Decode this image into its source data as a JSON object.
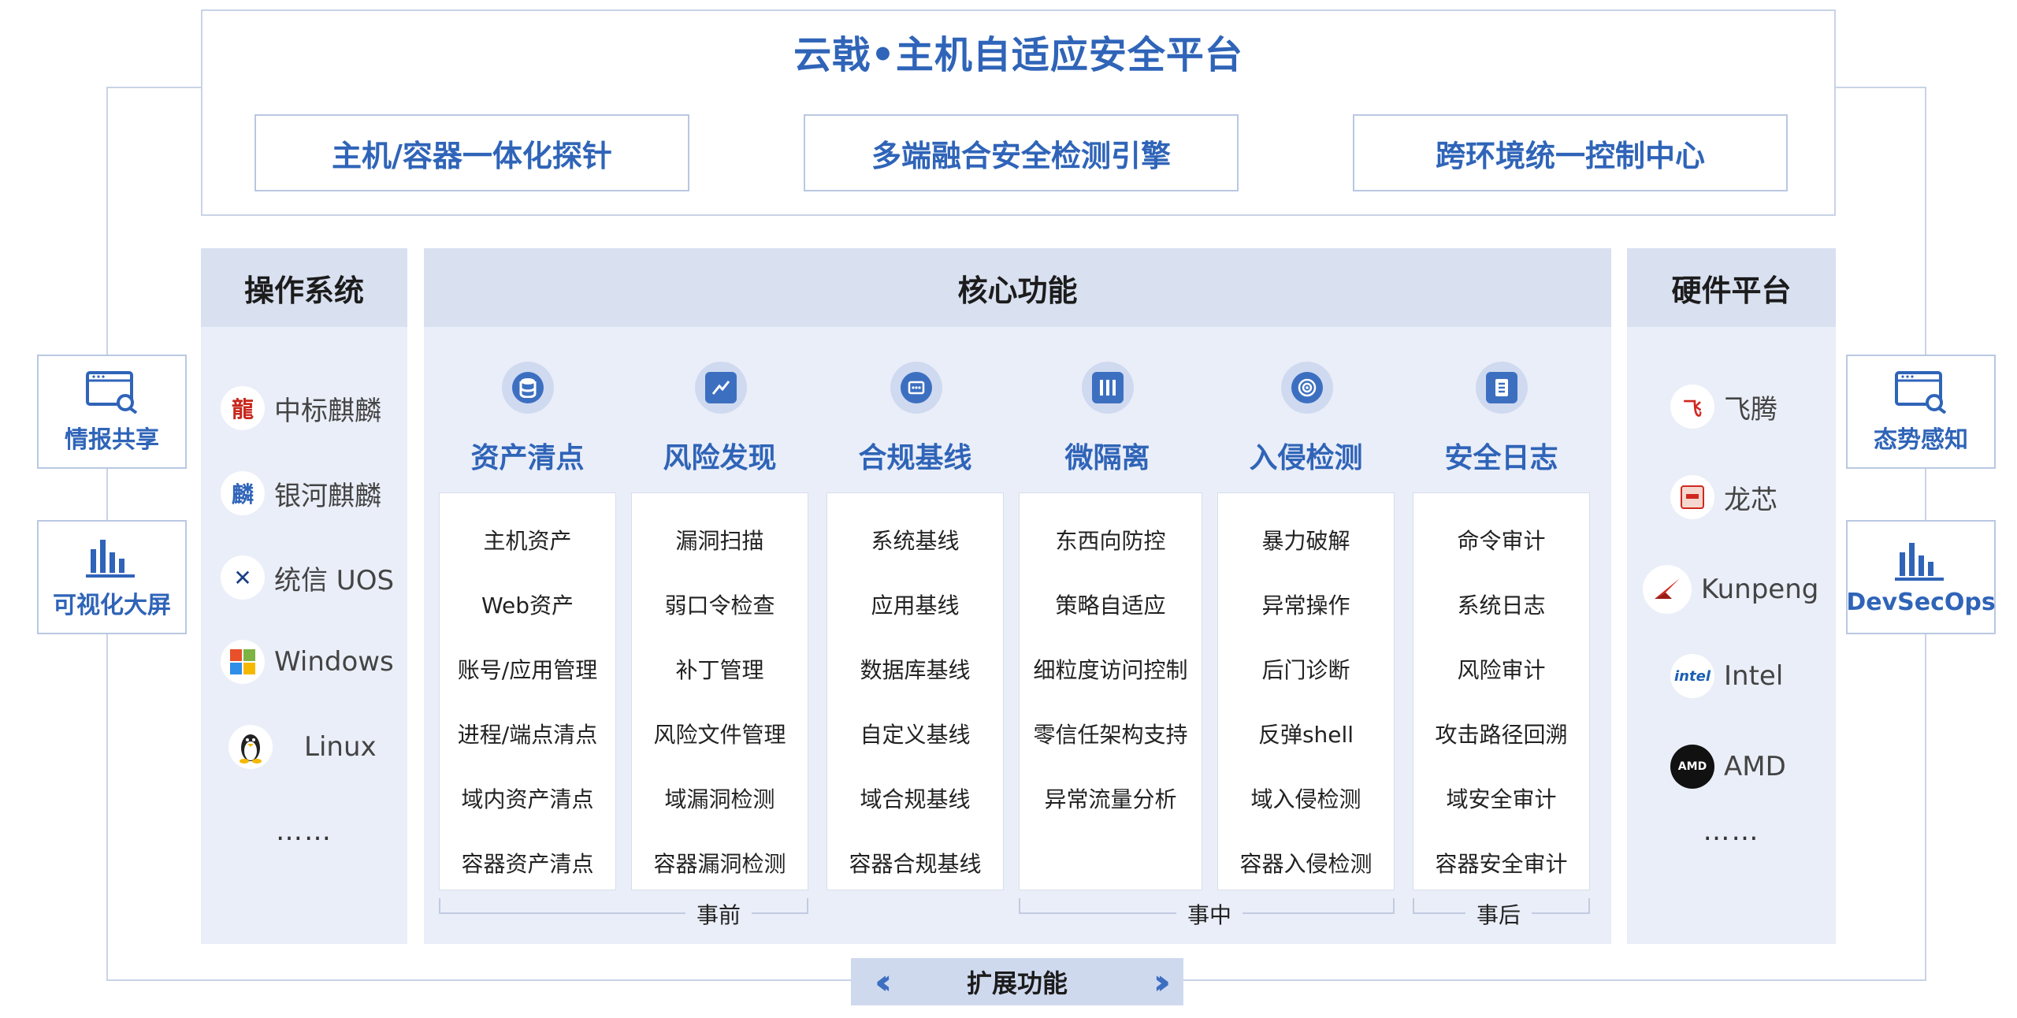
{
  "title": "云戟•主机自适应安全平台",
  "top_boxes": [
    "主机/容器一体化探针",
    "多端融合安全检测引擎",
    "跨环境统一控制中心"
  ],
  "os": {
    "title": "操作系统",
    "items": [
      "中标麒麟",
      "银河麒麟",
      "统信 UOS",
      "Windows",
      "Linux"
    ],
    "more": "……"
  },
  "core": {
    "title": "核心功能",
    "columns": [
      {
        "title": "资产清点",
        "items": [
          "主机资产",
          "Web资产",
          "账号/应用管理",
          "进程/端点清点",
          "域内资产清点",
          "容器资产清点"
        ]
      },
      {
        "title": "风险发现",
        "items": [
          "漏洞扫描",
          "弱口令检查",
          "补丁管理",
          "风险文件管理",
          "域漏洞检测",
          "容器漏洞检测"
        ]
      },
      {
        "title": "合规基线",
        "items": [
          "系统基线",
          "应用基线",
          "数据库基线",
          "自定义基线",
          "域合规基线",
          "容器合规基线"
        ]
      },
      {
        "title": "微隔离",
        "items": [
          "东西向防控",
          "策略自适应",
          "细粒度访问控制",
          "零信任架构支持",
          "异常流量分析"
        ]
      },
      {
        "title": "入侵检测",
        "items": [
          "暴力破解",
          "异常操作",
          "后门诊断",
          "反弹shell",
          "域入侵检测",
          "容器入侵检测"
        ]
      },
      {
        "title": "安全日志",
        "items": [
          "命令审计",
          "系统日志",
          "风险审计",
          "攻击路径回溯",
          "域安全审计",
          "容器安全审计"
        ]
      }
    ],
    "phases": [
      "事前",
      "事中",
      "事后"
    ]
  },
  "hardware": {
    "title": "硬件平台",
    "items": [
      "飞腾",
      "龙芯",
      "Kunpeng",
      "Intel",
      "AMD"
    ],
    "more": "……"
  },
  "side_left": [
    "情报共享",
    "可视化大屏"
  ],
  "side_right": [
    "态势感知",
    "DevSecOps"
  ],
  "extension": "扩展功能",
  "colors": {
    "accent": "#2f64b8",
    "panel": "#eaeef8",
    "panel_head": "#d9e0f0",
    "border": "#c9d3e6"
  }
}
